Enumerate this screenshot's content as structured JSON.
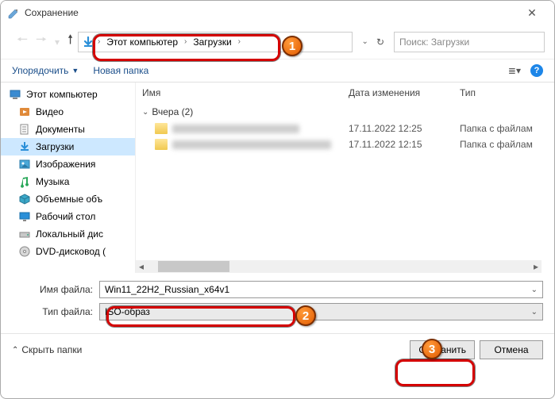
{
  "titlebar": {
    "title": "Сохранение"
  },
  "address": {
    "crumb1": "Этот компьютер",
    "crumb2": "Загрузки"
  },
  "search": {
    "placeholder": "Поиск: Загрузки"
  },
  "toolbar": {
    "organize": "Упорядочить",
    "newfolder": "Новая папка"
  },
  "sidebar": {
    "thispc": "Этот компьютер",
    "videos": "Видео",
    "documents": "Документы",
    "downloads": "Загрузки",
    "pictures": "Изображения",
    "music": "Музыка",
    "objects3d": "Объемные объ",
    "desktop": "Рабочий стол",
    "localdisk": "Локальный дис",
    "dvd": "DVD-дисковод ("
  },
  "columns": {
    "name": "Имя",
    "date": "Дата изменения",
    "type": "Тип"
  },
  "group": {
    "label": "Вчера (2)"
  },
  "files": [
    {
      "date": "17.11.2022 12:25",
      "type": "Папка с файлам"
    },
    {
      "date": "17.11.2022 12:15",
      "type": "Папка с файлам"
    }
  ],
  "form": {
    "filename_label": "Имя файла:",
    "filename_value": "Win11_22H2_Russian_x64v1",
    "filetype_label": "Тип файла:",
    "filetype_value": "ISO-образ"
  },
  "bottom": {
    "hide": "Скрыть папки",
    "save": "Сохранить",
    "cancel": "Отмена"
  },
  "badges": {
    "b1": "1",
    "b2": "2",
    "b3": "3"
  }
}
